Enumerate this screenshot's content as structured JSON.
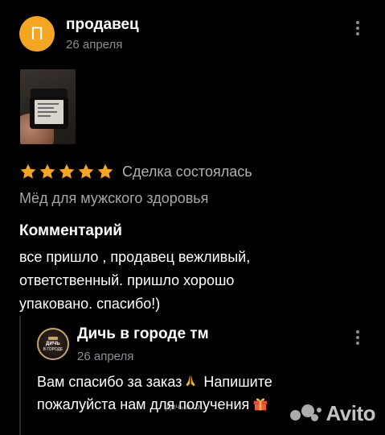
{
  "review": {
    "avatar_letter": "П",
    "avatar_color": "#f4a623",
    "author": "продавец",
    "date": "26 апреля",
    "photo_icon": "product-photo-honey-jar",
    "rating": 5,
    "rating_max": 5,
    "star_color": "#f4a623",
    "deal_status": "Сделка состоялась",
    "product_name": "Мёд для мужского здоровья",
    "comment_title": "Комментарий",
    "comment_lines": [
      "все пришло , продавец вежливый,",
      "ответственный. пришло хорошо",
      "упаковано. спасибо!)"
    ]
  },
  "reply": {
    "author": "Дичь в городе тм",
    "date": "26 апреля",
    "avatar_logo_top": "ДИЧЬ",
    "avatar_logo_bottom": "В ГОРОДЕ",
    "line1_before_emoji": "Вам спасибо за заказ",
    "line1_after_emoji": " Напишите",
    "line2": "пожалуйста нам для получения",
    "emoji_icons": [
      "folded-hands-icon",
      "gift-icon"
    ]
  },
  "watermark": {
    "overlay_text": "Дичь в го...",
    "brand": "Avito"
  }
}
